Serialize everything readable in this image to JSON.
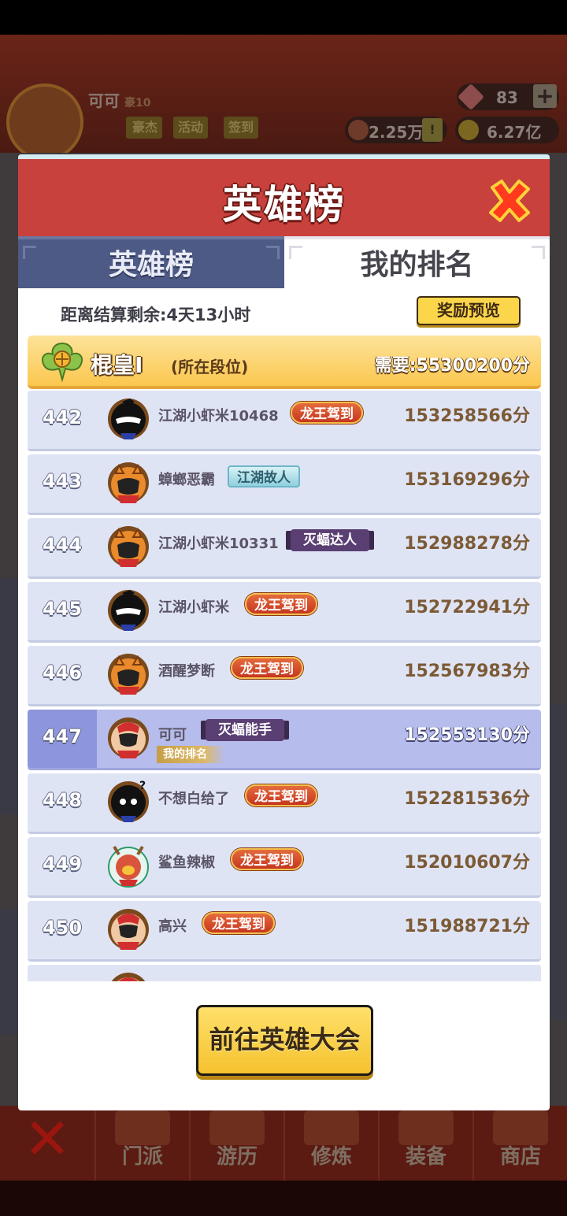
{
  "background": {
    "player": {
      "name": "可可",
      "rank_tag": "豪10"
    },
    "buttons": [
      "豪杰",
      "活动",
      "签到"
    ],
    "gems": "83",
    "resource1": "2.25万",
    "resource2": "6.27亿",
    "bottom_nav": [
      "门派",
      "游历",
      "修炼",
      "装备",
      "商店"
    ]
  },
  "modal": {
    "title": "英雄榜",
    "tabs": {
      "left": "英雄榜",
      "right": "我的排名"
    },
    "countdown": "距离结算剩余:4天13小时",
    "reward_button": "奖励预览",
    "tier": {
      "name": "棍皇Ⅰ",
      "note": "(所在段位)",
      "need": "需要:55300200分"
    },
    "rows": [
      {
        "rank": "442",
        "name": "江湖小虾米10468",
        "badge": "龙王驾到",
        "score": "153258566分"
      },
      {
        "rank": "443",
        "name": "蟑螂恶霸",
        "badge": "江湖故人",
        "score": "153169296分"
      },
      {
        "rank": "444",
        "name": "江湖小虾米10331",
        "badge": "灭蝠达人",
        "score": "152988278分"
      },
      {
        "rank": "445",
        "name": "江湖小虾米",
        "badge": "龙王驾到",
        "score": "152722941分"
      },
      {
        "rank": "446",
        "name": "酒醒梦断",
        "badge": "龙王驾到",
        "score": "152567983分"
      },
      {
        "rank": "447",
        "name": "可可",
        "badge": "灭蝠能手",
        "score": "152553130分",
        "mine_tag": "我的排名"
      },
      {
        "rank": "448",
        "name": "不想白给了",
        "badge": "龙王驾到",
        "score": "152281536分"
      },
      {
        "rank": "449",
        "name": "鲨鱼辣椒",
        "badge": "龙王驾到",
        "score": "152010607分"
      },
      {
        "rank": "450",
        "name": "高兴",
        "badge": "龙王驾到",
        "score": "151988721分"
      }
    ],
    "go_button": "前往英雄大会"
  },
  "icons": {
    "close": "close-icon",
    "tier": "tier-emblem-icon",
    "avatars": [
      "ninja-avatar-icon",
      "tiger-avatar-icon",
      "deer-avatar-icon"
    ]
  },
  "colors": {
    "header_red": "#c9413c",
    "tab_inactive": "#4e5a86",
    "row_bg": "#dfe4f5",
    "row_mine": "#b6bcec",
    "score_brown": "#7c5a35",
    "gold_button": "#fbd64a"
  }
}
